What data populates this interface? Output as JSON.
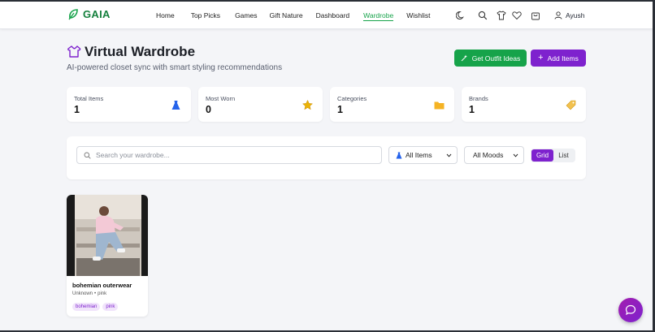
{
  "brand": {
    "name": "GAIA",
    "color": "#16a34a"
  },
  "nav": {
    "items": [
      {
        "label": "Home"
      },
      {
        "label": "Top Picks"
      },
      {
        "label": "Games"
      },
      {
        "label": "Gift Nature"
      },
      {
        "label": "Dashboard"
      },
      {
        "label": "Wardrobe",
        "active": true
      },
      {
        "label": "Wishlist"
      }
    ]
  },
  "header_icons": [
    "moon-icon",
    "search-icon",
    "shirt-icon",
    "heart-icon",
    "shopping-bag-icon"
  ],
  "user": {
    "name": "Ayush"
  },
  "page": {
    "title": "Virtual Wardrobe",
    "subtitle": "AI-powered closet sync with smart styling recommendations"
  },
  "actions": {
    "outfit_label": "Get Outfit Ideas",
    "add_label": "Add Items"
  },
  "stats": [
    {
      "label": "Total Items",
      "value": "1",
      "icon": "dress-icon"
    },
    {
      "label": "Most Worn",
      "value": "0",
      "icon": "star-icon"
    },
    {
      "label": "Categories",
      "value": "1",
      "icon": "folder-icon"
    },
    {
      "label": "Brands",
      "value": "1",
      "icon": "tag-icon"
    }
  ],
  "filters": {
    "search_placeholder": "Search your wardrobe...",
    "category_selected": "All Items",
    "mood_selected": "All Moods",
    "view_grid_label": "Grid",
    "view_list_label": "List",
    "view_selected": "Grid"
  },
  "items": [
    {
      "name": "bohemian outerwear",
      "brand": "Unknown",
      "separator": "•",
      "color": "pink",
      "tags": [
        "bohemian",
        "pink"
      ]
    }
  ],
  "colors": {
    "accent_green": "#16a34a",
    "accent_purple": "#7e22ce",
    "background": "#f4f5f8"
  }
}
